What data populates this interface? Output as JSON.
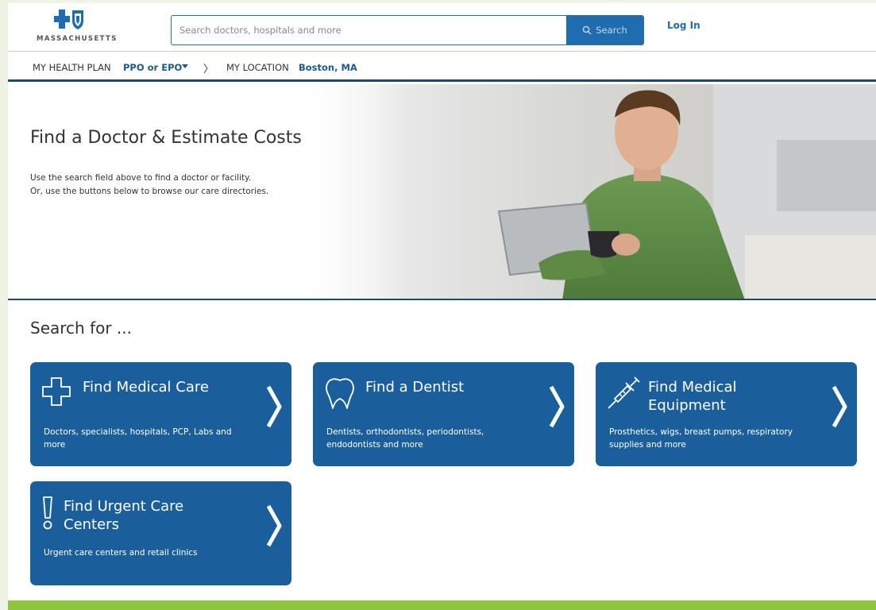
{
  "header": {
    "logo_text": "MASSACHUSETTS",
    "search_placeholder": "Search doctors, hospitals and more",
    "search_button": "Search",
    "login": "Log In"
  },
  "planbar": {
    "health_plan_label": "MY HEALTH PLAN",
    "health_plan_value": "PPO or EPO",
    "separator": "〉",
    "location_label": "MY LOCATION",
    "location_value": "Boston, MA"
  },
  "hero": {
    "title": "Find a Doctor & Estimate Costs",
    "line1": "Use the search field above to find a doctor or facility.",
    "line2": "Or, use the buttons below to browse our care directories."
  },
  "section_title": "Search for ...",
  "cards": [
    {
      "title": "Find Medical Care",
      "desc": "Doctors, specialists, hospitals, PCP, Labs and more",
      "icon": "medical-cross-icon"
    },
    {
      "title": "Find a Dentist",
      "desc": "Dentists, orthodontists, periodontists, endodontists and more",
      "icon": "tooth-icon"
    },
    {
      "title": "Find Medical Equipment",
      "desc": "Prosthetics, wigs, breast pumps, respiratory supplies and more",
      "icon": "syringe-icon"
    },
    {
      "title": "Find Urgent Care Centers",
      "desc": "Urgent care centers and retail clinics",
      "icon": "exclamation-icon"
    }
  ],
  "colors": {
    "brand_blue": "#1a5f9c",
    "navy": "#1c4a6c",
    "green_bar": "#8cc63e"
  }
}
